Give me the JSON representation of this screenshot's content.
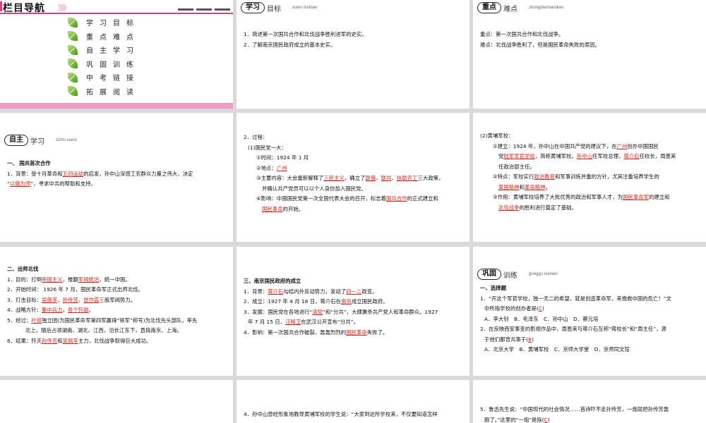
{
  "nav": {
    "title": "栏目导航",
    "arrows": "》》》",
    "items": [
      "学习目标",
      "重点难点",
      "自主学习",
      "巩固训练",
      "中考链接",
      "拓展阅读"
    ]
  },
  "s2": {
    "badge": "学习",
    "word": "目标",
    "pinyin": "xuexi mubiao",
    "lines": [
      "1．简述第一次国共合作和北伐战争胜利进军的史实。",
      "2．了解南京国民政府成立的基本史实。"
    ]
  },
  "s3": {
    "badge": "重点",
    "word": "难点",
    "pinyin": "zhongdiannandian",
    "lines": [
      "重点：第一次国共合作和北伐战争。",
      "难点：北伐战争胜利了，但是国民革命失败的原因。"
    ]
  },
  "s4": {
    "badge": "自主",
    "word": "学习",
    "pinyin": "zizhu xuexi",
    "heading": "一、 国共首次合作",
    "l1a": "1．背景：受十月革命和",
    "l1b": "五四运动",
    "l1c": "的启发，孙中山深感工农群众力量之伟大，决定",
    "l2a": "“",
    "l2b": "以俄为师",
    "l2c": "”，寻求中共的帮助和支持。"
  },
  "s5": {
    "l1": "2．过程：",
    "l2": "(1)国民党一大：",
    "l3": "①时间：1924 年 1 月",
    "l4a": "②地点：",
    "l4b": "广州",
    "l5a": "③主要内容：大会重新解释了",
    "l5b": "三民主义",
    "l5c": "，确立了",
    "l5d": "联俄",
    "l5e": "、",
    "l5f": "联共",
    "l5g": "、",
    "l5h": "扶助农工",
    "l5i": "三大政策，",
    "l6": "并确认共产党员可以以个人身份加入国民党。",
    "l7a": "④影响：中国国民党第一次全国代表大会的召开，标志着",
    "l7b": "国共合作",
    "l7c": "的正式建立和",
    "l8a": "国民革命",
    "l8b": "的开始。"
  },
  "s6": {
    "l1": "(2)黄埔军校：",
    "l2a": "①建立：1924 年，孙中山在中国共产党的建议下，在",
    "l2b": "广州",
    "l2c": "创办中国国民",
    "l3a": "党",
    "l3b": "陆军军官学校",
    "l3c": "，简称黄埔军校。",
    "l3d": "孙中山",
    "l3e": "任军校总理，",
    "l3f": "蒋介石",
    "l3g": "任校长，周恩来",
    "l4": "任政治部主任。",
    "l5a": "②特点：军校实行",
    "l5b": "政治教育",
    "l5c": "和军事训练并重的方针，尤其注重培养学生的",
    "l6a": "爱国精神",
    "l6b": "和",
    "l6c": "革命精神",
    "l6d": "。",
    "l7a": "③作用：黄埔军校培养了大批优秀的政治和军事人才，为",
    "l7b": "国民革命军",
    "l7c": "的建立和",
    "l8a": "北伐战争",
    "l8b": "的胜利进行奠定了基础。"
  },
  "s7": {
    "heading": "二、出师北伐",
    "l1a": "1．目的：打倒",
    "l1b": "帝国主义",
    "l1c": "，推翻",
    "l1d": "军阀统治",
    "l1e": "，统一中国。",
    "l2": "2．开始时间： 1926 年 7 月，国民革命军正式出师北伐。",
    "l3a": "3．打击目标：",
    "l3b": "吴佩孚",
    "l3c": "、",
    "l3d": "孙传芳",
    "l3e": "、",
    "l3f": "张作霖",
    "l3g": "三股军阀势力。",
    "l4a": "4．战略方针：",
    "l4b": "集中兵力",
    "l4c": "、",
    "l4d": "各个歼敌",
    "l4e": "。",
    "l5a": "5．经过：",
    "l5b": "叶挺",
    "l5c": "独立团(为国民革命军第四军赢得“铁军”称号)为北伐先头部队，率先",
    "l6": "北上。随后占领湖南、湖北、江西，沿长江东下，直捣南京、上海。",
    "l7a": "6．结果：歼灭",
    "l7b": "孙传芳",
    "l7c": "和",
    "l7d": "吴佩孚",
    "l7e": "主力，北伐战争取得巨大成功。"
  },
  "s8": {
    "heading": "三、南京国民政府的成立",
    "l1a": "1．背景：",
    "l1b": "蒋介石",
    "l1c": "勾结内外反动势力，发动了",
    "l1d": "四一二",
    "l1e": "政变。",
    "l2a": "2．成立：1927 年 4 月 18 日，蒋介石在",
    "l2b": "南京",
    "l2c": "成立国民政府。",
    "l3a": "3．发展：国民党在各地进行“",
    "l3b": "清党",
    "l3c": "”和“分共”，大肆屠杀共产党人和革命群众。1927",
    "l4a": "年 7 月 15 日，",
    "l4b": "汪精卫",
    "l4c": "在武汉公开宣布“分共”。",
    "l5a": "4．影响：第一次国共合作破裂，轰轰烈烈的",
    "l5b": "国民革命",
    "l5c": "失败了。"
  },
  "s9": {
    "badge": "巩固",
    "word": "训练",
    "pinyin": "gonggu xunlian",
    "heading": "一、选择题",
    "l1": "1．“开这个军官学校，独一无二的希望，就是创造革命军，来挽救中国的危亡！”文",
    "l2a": "中所指学校的创办者是(",
    "l2b": "C",
    "l2c": ")",
    "l3": "A．李大钊　B．毛泽东　C．孙中山　D．蔡元培",
    "l4": "2．在反映西安事变的影视作品中，周恩来与蒋介石互称“蒋校长”和“周主任”，源",
    "l5a": "于他们都曾共事于(",
    "l5b": "B",
    "l5c": ")",
    "l6": "A．北京大学　B．黄埔军校　C．京师大学堂　D．京师同文馆"
  },
  "s11": {
    "l1": "4．孙中山曾经形象地教导黄埔军校的学生说：“大家到这所学校来，不仅要知道怎样"
  },
  "s12": {
    "l1": "5．鲁迅先生说：“中国现代的社会情况……首诗吓不走孙传芳，一炮就把孙传芳轰",
    "l2a": "跑了。”这里的“一炮”是指(",
    "l2b": "C",
    "l2c": ")"
  }
}
